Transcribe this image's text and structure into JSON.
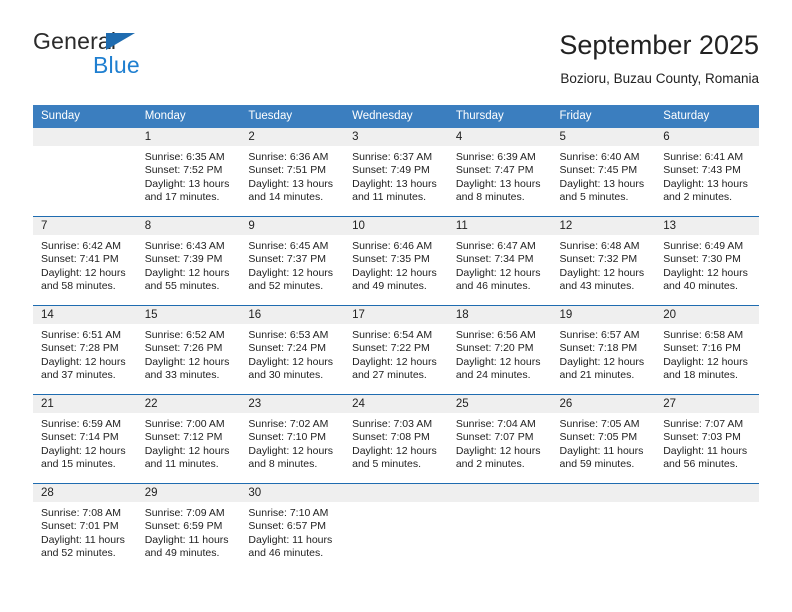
{
  "brand": {
    "name_part1": "General",
    "name_part2": "Blue",
    "accent_color": "#1f7fd0",
    "triangle_color": "#1f6cb0"
  },
  "header": {
    "title": "September 2025",
    "subtitle": "Bozioru, Buzau County, Romania"
  },
  "calendar": {
    "header_bg": "#3b7ebf",
    "daynum_bg": "#efefef",
    "separator_color": "#1f6cb0",
    "weekdays": [
      "Sunday",
      "Monday",
      "Tuesday",
      "Wednesday",
      "Thursday",
      "Friday",
      "Saturday"
    ],
    "weeks": [
      [
        {
          "day": "",
          "lines": []
        },
        {
          "day": "1",
          "lines": [
            "Sunrise: 6:35 AM",
            "Sunset: 7:52 PM",
            "Daylight: 13 hours",
            "and 17 minutes."
          ]
        },
        {
          "day": "2",
          "lines": [
            "Sunrise: 6:36 AM",
            "Sunset: 7:51 PM",
            "Daylight: 13 hours",
            "and 14 minutes."
          ]
        },
        {
          "day": "3",
          "lines": [
            "Sunrise: 6:37 AM",
            "Sunset: 7:49 PM",
            "Daylight: 13 hours",
            "and 11 minutes."
          ]
        },
        {
          "day": "4",
          "lines": [
            "Sunrise: 6:39 AM",
            "Sunset: 7:47 PM",
            "Daylight: 13 hours",
            "and 8 minutes."
          ]
        },
        {
          "day": "5",
          "lines": [
            "Sunrise: 6:40 AM",
            "Sunset: 7:45 PM",
            "Daylight: 13 hours",
            "and 5 minutes."
          ]
        },
        {
          "day": "6",
          "lines": [
            "Sunrise: 6:41 AM",
            "Sunset: 7:43 PM",
            "Daylight: 13 hours",
            "and 2 minutes."
          ]
        }
      ],
      [
        {
          "day": "7",
          "lines": [
            "Sunrise: 6:42 AM",
            "Sunset: 7:41 PM",
            "Daylight: 12 hours",
            "and 58 minutes."
          ]
        },
        {
          "day": "8",
          "lines": [
            "Sunrise: 6:43 AM",
            "Sunset: 7:39 PM",
            "Daylight: 12 hours",
            "and 55 minutes."
          ]
        },
        {
          "day": "9",
          "lines": [
            "Sunrise: 6:45 AM",
            "Sunset: 7:37 PM",
            "Daylight: 12 hours",
            "and 52 minutes."
          ]
        },
        {
          "day": "10",
          "lines": [
            "Sunrise: 6:46 AM",
            "Sunset: 7:35 PM",
            "Daylight: 12 hours",
            "and 49 minutes."
          ]
        },
        {
          "day": "11",
          "lines": [
            "Sunrise: 6:47 AM",
            "Sunset: 7:34 PM",
            "Daylight: 12 hours",
            "and 46 minutes."
          ]
        },
        {
          "day": "12",
          "lines": [
            "Sunrise: 6:48 AM",
            "Sunset: 7:32 PM",
            "Daylight: 12 hours",
            "and 43 minutes."
          ]
        },
        {
          "day": "13",
          "lines": [
            "Sunrise: 6:49 AM",
            "Sunset: 7:30 PM",
            "Daylight: 12 hours",
            "and 40 minutes."
          ]
        }
      ],
      [
        {
          "day": "14",
          "lines": [
            "Sunrise: 6:51 AM",
            "Sunset: 7:28 PM",
            "Daylight: 12 hours",
            "and 37 minutes."
          ]
        },
        {
          "day": "15",
          "lines": [
            "Sunrise: 6:52 AM",
            "Sunset: 7:26 PM",
            "Daylight: 12 hours",
            "and 33 minutes."
          ]
        },
        {
          "day": "16",
          "lines": [
            "Sunrise: 6:53 AM",
            "Sunset: 7:24 PM",
            "Daylight: 12 hours",
            "and 30 minutes."
          ]
        },
        {
          "day": "17",
          "lines": [
            "Sunrise: 6:54 AM",
            "Sunset: 7:22 PM",
            "Daylight: 12 hours",
            "and 27 minutes."
          ]
        },
        {
          "day": "18",
          "lines": [
            "Sunrise: 6:56 AM",
            "Sunset: 7:20 PM",
            "Daylight: 12 hours",
            "and 24 minutes."
          ]
        },
        {
          "day": "19",
          "lines": [
            "Sunrise: 6:57 AM",
            "Sunset: 7:18 PM",
            "Daylight: 12 hours",
            "and 21 minutes."
          ]
        },
        {
          "day": "20",
          "lines": [
            "Sunrise: 6:58 AM",
            "Sunset: 7:16 PM",
            "Daylight: 12 hours",
            "and 18 minutes."
          ]
        }
      ],
      [
        {
          "day": "21",
          "lines": [
            "Sunrise: 6:59 AM",
            "Sunset: 7:14 PM",
            "Daylight: 12 hours",
            "and 15 minutes."
          ]
        },
        {
          "day": "22",
          "lines": [
            "Sunrise: 7:00 AM",
            "Sunset: 7:12 PM",
            "Daylight: 12 hours",
            "and 11 minutes."
          ]
        },
        {
          "day": "23",
          "lines": [
            "Sunrise: 7:02 AM",
            "Sunset: 7:10 PM",
            "Daylight: 12 hours",
            "and 8 minutes."
          ]
        },
        {
          "day": "24",
          "lines": [
            "Sunrise: 7:03 AM",
            "Sunset: 7:08 PM",
            "Daylight: 12 hours",
            "and 5 minutes."
          ]
        },
        {
          "day": "25",
          "lines": [
            "Sunrise: 7:04 AM",
            "Sunset: 7:07 PM",
            "Daylight: 12 hours",
            "and 2 minutes."
          ]
        },
        {
          "day": "26",
          "lines": [
            "Sunrise: 7:05 AM",
            "Sunset: 7:05 PM",
            "Daylight: 11 hours",
            "and 59 minutes."
          ]
        },
        {
          "day": "27",
          "lines": [
            "Sunrise: 7:07 AM",
            "Sunset: 7:03 PM",
            "Daylight: 11 hours",
            "and 56 minutes."
          ]
        }
      ],
      [
        {
          "day": "28",
          "lines": [
            "Sunrise: 7:08 AM",
            "Sunset: 7:01 PM",
            "Daylight: 11 hours",
            "and 52 minutes."
          ]
        },
        {
          "day": "29",
          "lines": [
            "Sunrise: 7:09 AM",
            "Sunset: 6:59 PM",
            "Daylight: 11 hours",
            "and 49 minutes."
          ]
        },
        {
          "day": "30",
          "lines": [
            "Sunrise: 7:10 AM",
            "Sunset: 6:57 PM",
            "Daylight: 11 hours",
            "and 46 minutes."
          ]
        },
        {
          "day": "",
          "lines": []
        },
        {
          "day": "",
          "lines": []
        },
        {
          "day": "",
          "lines": []
        },
        {
          "day": "",
          "lines": []
        }
      ]
    ]
  }
}
